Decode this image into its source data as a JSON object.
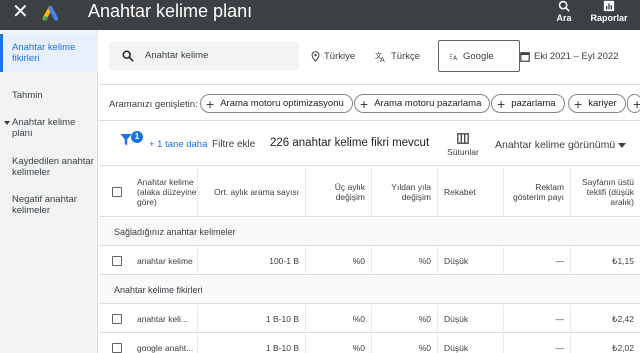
{
  "topbar": {
    "close_icon": "close-icon",
    "title": "Anahtar kelime planı",
    "search_label": "Ara",
    "reports_label": "Raporlar"
  },
  "sidebar": {
    "items": [
      {
        "label": "Anahtar kelime fikirleri",
        "active": true
      },
      {
        "label": "Tahmin"
      },
      {
        "label": "Anahtar kelime planı"
      },
      {
        "label": "Kaydedilen anahtar kelimeler"
      },
      {
        "label": "Negatif anahtar kelimeler"
      }
    ]
  },
  "search": {
    "value": "Anahtar kelime",
    "location": "Türkiye",
    "language": "Türkçe",
    "network": "Google",
    "date_range": "Eki 2021 – Eyl 2022"
  },
  "expand": {
    "label": "Aramanızı genişletin:",
    "chips": [
      "Arama motoru optimizasyonu",
      "Arama motoru pazarlama",
      "pazarlama",
      "kariyer"
    ]
  },
  "filters": {
    "badge": "1",
    "more_link": "+ 1 tane daha",
    "add_filter": "Filtre ekle",
    "count_text": "226 anahtar kelime fikri mevcut",
    "columns_label": "Sütunlar",
    "view_label": "Anahtar kelime görünümü"
  },
  "table": {
    "headers": [
      "Anahtar kelime (alaka düzeyine göre)",
      "Ort. aylık arama sayısı",
      "Üç aylık değişim",
      "Yıldan yıla değişim",
      "Rekabet",
      "Reklam gösterim payı",
      "Sayfanın üstü teklifi (düşük aralık)"
    ],
    "group_provided": "Sağladığınız anahtar kelimeler",
    "group_ideas": "Anahtar kelime fikirleri",
    "provided_rows": [
      {
        "keyword": "anahtar kelime",
        "searches": "100-1 B",
        "qoq": "%0",
        "yoy": "%0",
        "competition": "Düşük",
        "share": "—",
        "bid": "₺1,15"
      }
    ],
    "idea_rows": [
      {
        "keyword": "anahtar keli...",
        "searches": "1 B-10 B",
        "qoq": "%0",
        "yoy": "%0",
        "competition": "Düşük",
        "share": "—",
        "bid": "₺2,42"
      },
      {
        "keyword": "google anaht...",
        "searches": "1 B-10 B",
        "qoq": "%0",
        "yoy": "%0",
        "competition": "Düşük",
        "share": "—",
        "bid": "₺2,02"
      }
    ]
  }
}
